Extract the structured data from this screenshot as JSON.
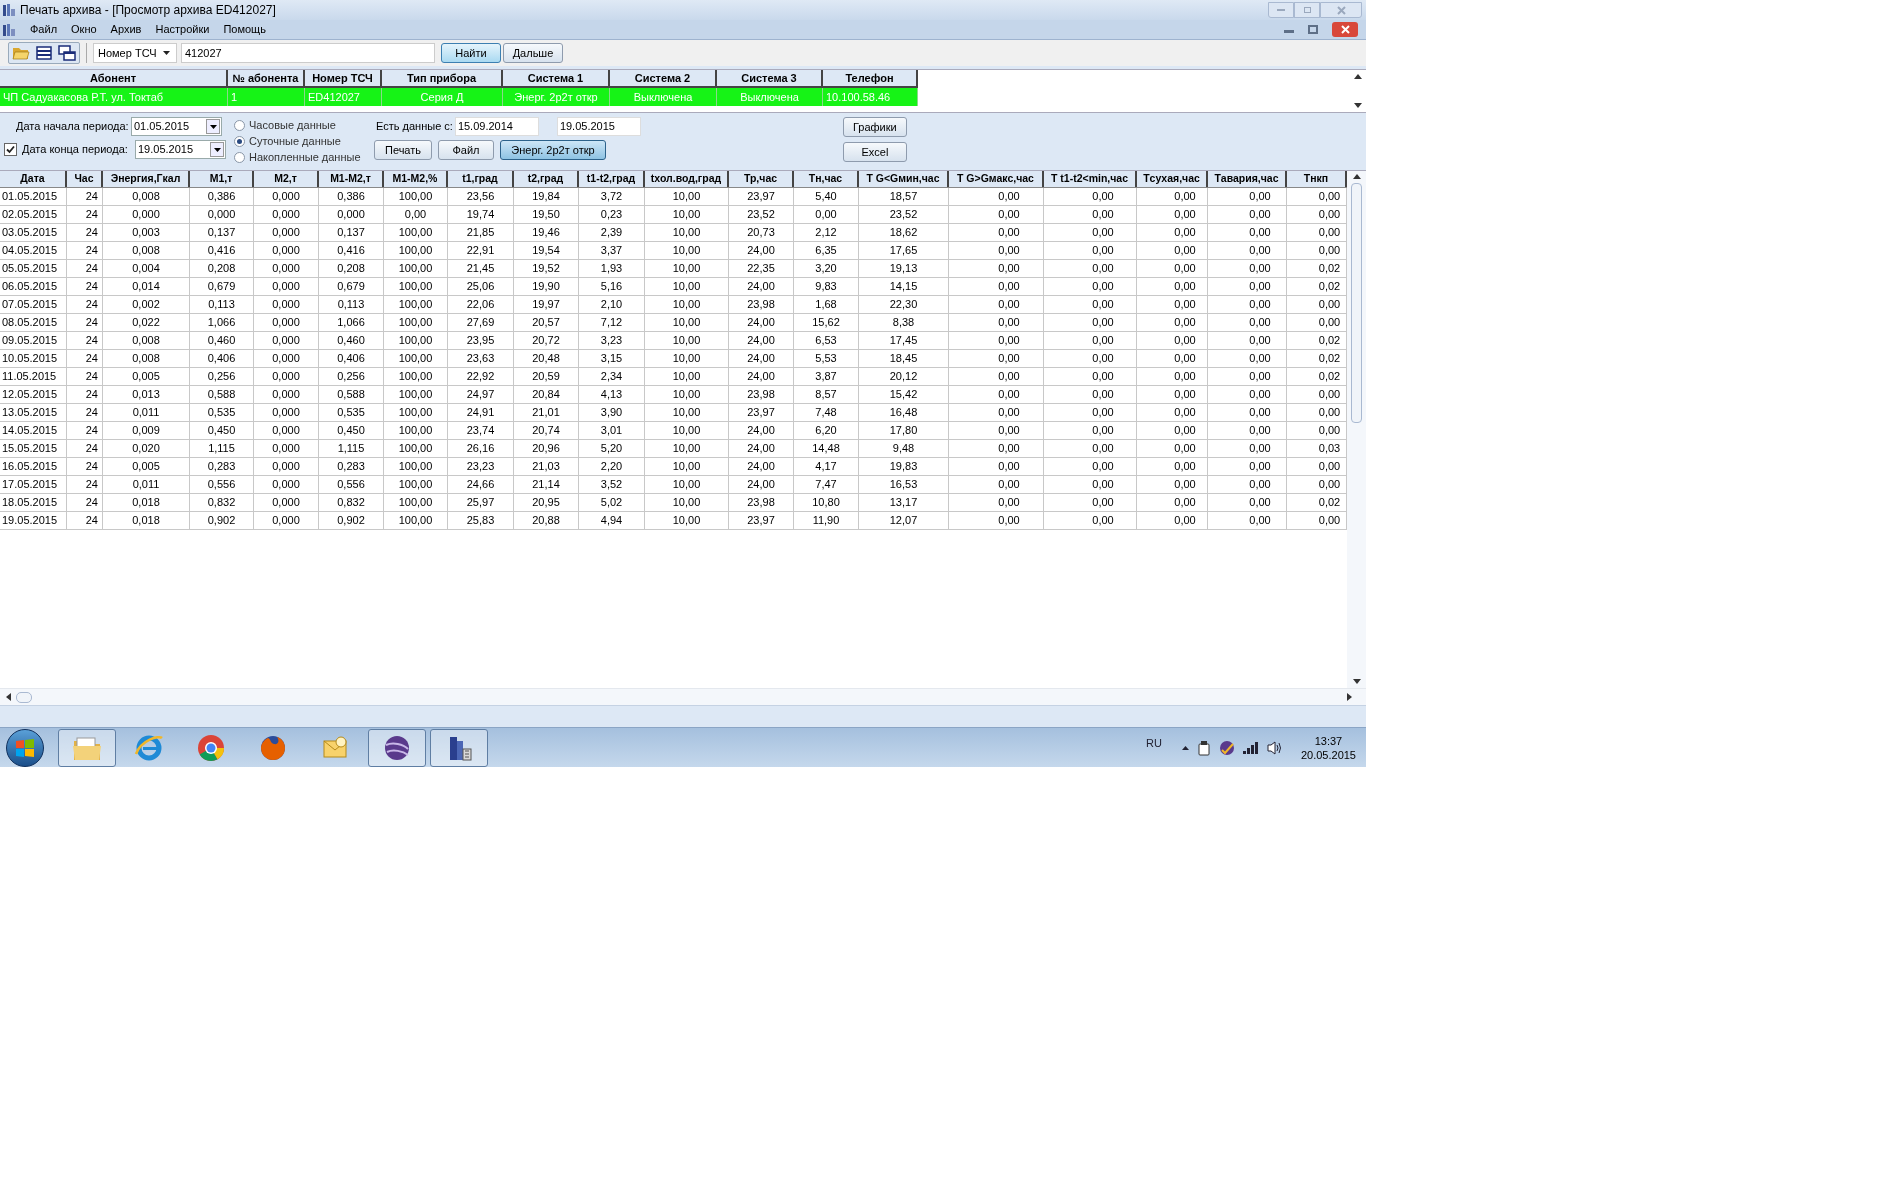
{
  "window": {
    "title": "Печать архива - [Просмотр архива ED412027]"
  },
  "menu": [
    "Файл",
    "Окно",
    "Архив",
    "Настройки",
    "Помощь"
  ],
  "toolbar": {
    "search_by": "Номер ТСЧ",
    "search_value": "412027",
    "buttons": [
      "Найти",
      "Дальше"
    ]
  },
  "subscribers": {
    "columns": [
      "Абонент",
      "№ абонента",
      "Номер ТСЧ",
      "Тип прибора",
      "Система 1",
      "Система 2",
      "Система 3",
      "Телефон"
    ],
    "rows": [
      {
        "selected": true,
        "cells": [
          "ЧП Садуакасова Р.Т. ул. Токтаб",
          "1",
          "ED412027",
          "Серия Д",
          "Энерг. 2р2т откр",
          "Выключена",
          "Выключена",
          "10.100.58.46"
        ]
      }
    ]
  },
  "period": {
    "start_label": "Дата начала периода:",
    "start": "01.05.2015",
    "end_label": "Дата конца периода:",
    "end": "19.05.2015",
    "end_checked": true,
    "modes": [
      {
        "label": "Часовые данные",
        "selected": false
      },
      {
        "label": "Суточные данные",
        "selected": true
      },
      {
        "label": "Накопленные данные",
        "selected": false
      }
    ],
    "available_label": "Есть данные с:",
    "available_from": "15.09.2014",
    "available_to": "19.05.2015",
    "buttons": [
      {
        "label": "Печать",
        "pressed": false
      },
      {
        "label": "Файл",
        "pressed": false
      },
      {
        "label": "Энерг. 2р2т откр",
        "pressed": true
      }
    ],
    "side_buttons": [
      "Графики",
      "Excel"
    ]
  },
  "table": {
    "columns": [
      "Дата",
      "Час",
      "Энергия,Гкал",
      "М1,т",
      "М2,т",
      "М1-М2,т",
      "М1-М2,%",
      "t1,град",
      "t2,град",
      "t1-t2,град",
      "tхол.вод,град",
      "Тр,час",
      "Тн,час",
      "T G<Gмин,час",
      "T G>Gмакс,час",
      "T t1-t2<min,час",
      "Tсухая,час",
      "Tавария,час",
      "Tнкп"
    ],
    "rows": [
      [
        "01.05.2015",
        "24",
        "0,008",
        "0,386",
        "0,000",
        "0,386",
        "100,00",
        "23,56",
        "19,84",
        "3,72",
        "10,00",
        "23,97",
        "5,40",
        "18,57",
        "0,00",
        "0,00",
        "0,00",
        "0,00",
        "0,00"
      ],
      [
        "02.05.2015",
        "24",
        "0,000",
        "0,000",
        "0,000",
        "0,000",
        "0,00",
        "19,74",
        "19,50",
        "0,23",
        "10,00",
        "23,52",
        "0,00",
        "23,52",
        "0,00",
        "0,00",
        "0,00",
        "0,00",
        "0,00"
      ],
      [
        "03.05.2015",
        "24",
        "0,003",
        "0,137",
        "0,000",
        "0,137",
        "100,00",
        "21,85",
        "19,46",
        "2,39",
        "10,00",
        "20,73",
        "2,12",
        "18,62",
        "0,00",
        "0,00",
        "0,00",
        "0,00",
        "0,00"
      ],
      [
        "04.05.2015",
        "24",
        "0,008",
        "0,416",
        "0,000",
        "0,416",
        "100,00",
        "22,91",
        "19,54",
        "3,37",
        "10,00",
        "24,00",
        "6,35",
        "17,65",
        "0,00",
        "0,00",
        "0,00",
        "0,00",
        "0,00"
      ],
      [
        "05.05.2015",
        "24",
        "0,004",
        "0,208",
        "0,000",
        "0,208",
        "100,00",
        "21,45",
        "19,52",
        "1,93",
        "10,00",
        "22,35",
        "3,20",
        "19,13",
        "0,00",
        "0,00",
        "0,00",
        "0,00",
        "0,02"
      ],
      [
        "06.05.2015",
        "24",
        "0,014",
        "0,679",
        "0,000",
        "0,679",
        "100,00",
        "25,06",
        "19,90",
        "5,16",
        "10,00",
        "24,00",
        "9,83",
        "14,15",
        "0,00",
        "0,00",
        "0,00",
        "0,00",
        "0,02"
      ],
      [
        "07.05.2015",
        "24",
        "0,002",
        "0,113",
        "0,000",
        "0,113",
        "100,00",
        "22,06",
        "19,97",
        "2,10",
        "10,00",
        "23,98",
        "1,68",
        "22,30",
        "0,00",
        "0,00",
        "0,00",
        "0,00",
        "0,00"
      ],
      [
        "08.05.2015",
        "24",
        "0,022",
        "1,066",
        "0,000",
        "1,066",
        "100,00",
        "27,69",
        "20,57",
        "7,12",
        "10,00",
        "24,00",
        "15,62",
        "8,38",
        "0,00",
        "0,00",
        "0,00",
        "0,00",
        "0,00"
      ],
      [
        "09.05.2015",
        "24",
        "0,008",
        "0,460",
        "0,000",
        "0,460",
        "100,00",
        "23,95",
        "20,72",
        "3,23",
        "10,00",
        "24,00",
        "6,53",
        "17,45",
        "0,00",
        "0,00",
        "0,00",
        "0,00",
        "0,02"
      ],
      [
        "10.05.2015",
        "24",
        "0,008",
        "0,406",
        "0,000",
        "0,406",
        "100,00",
        "23,63",
        "20,48",
        "3,15",
        "10,00",
        "24,00",
        "5,53",
        "18,45",
        "0,00",
        "0,00",
        "0,00",
        "0,00",
        "0,02"
      ],
      [
        "11.05.2015",
        "24",
        "0,005",
        "0,256",
        "0,000",
        "0,256",
        "100,00",
        "22,92",
        "20,59",
        "2,34",
        "10,00",
        "24,00",
        "3,87",
        "20,12",
        "0,00",
        "0,00",
        "0,00",
        "0,00",
        "0,02"
      ],
      [
        "12.05.2015",
        "24",
        "0,013",
        "0,588",
        "0,000",
        "0,588",
        "100,00",
        "24,97",
        "20,84",
        "4,13",
        "10,00",
        "23,98",
        "8,57",
        "15,42",
        "0,00",
        "0,00",
        "0,00",
        "0,00",
        "0,00"
      ],
      [
        "13.05.2015",
        "24",
        "0,011",
        "0,535",
        "0,000",
        "0,535",
        "100,00",
        "24,91",
        "21,01",
        "3,90",
        "10,00",
        "23,97",
        "7,48",
        "16,48",
        "0,00",
        "0,00",
        "0,00",
        "0,00",
        "0,00"
      ],
      [
        "14.05.2015",
        "24",
        "0,009",
        "0,450",
        "0,000",
        "0,450",
        "100,00",
        "23,74",
        "20,74",
        "3,01",
        "10,00",
        "24,00",
        "6,20",
        "17,80",
        "0,00",
        "0,00",
        "0,00",
        "0,00",
        "0,00"
      ],
      [
        "15.05.2015",
        "24",
        "0,020",
        "1,115",
        "0,000",
        "1,115",
        "100,00",
        "26,16",
        "20,96",
        "5,20",
        "10,00",
        "24,00",
        "14,48",
        "9,48",
        "0,00",
        "0,00",
        "0,00",
        "0,00",
        "0,03"
      ],
      [
        "16.05.2015",
        "24",
        "0,005",
        "0,283",
        "0,000",
        "0,283",
        "100,00",
        "23,23",
        "21,03",
        "2,20",
        "10,00",
        "24,00",
        "4,17",
        "19,83",
        "0,00",
        "0,00",
        "0,00",
        "0,00",
        "0,00"
      ],
      [
        "17.05.2015",
        "24",
        "0,011",
        "0,556",
        "0,000",
        "0,556",
        "100,00",
        "24,66",
        "21,14",
        "3,52",
        "10,00",
        "24,00",
        "7,47",
        "16,53",
        "0,00",
        "0,00",
        "0,00",
        "0,00",
        "0,00"
      ],
      [
        "18.05.2015",
        "24",
        "0,018",
        "0,832",
        "0,000",
        "0,832",
        "100,00",
        "25,97",
        "20,95",
        "5,02",
        "10,00",
        "23,98",
        "10,80",
        "13,17",
        "0,00",
        "0,00",
        "0,00",
        "0,00",
        "0,02"
      ],
      [
        "19.05.2015",
        "24",
        "0,018",
        "0,902",
        "0,000",
        "0,902",
        "100,00",
        "25,83",
        "20,88",
        "4,94",
        "10,00",
        "23,97",
        "11,90",
        "12,07",
        "0,00",
        "0,00",
        "0,00",
        "0,00",
        "0,00"
      ]
    ]
  },
  "taskbar": {
    "apps": [
      {
        "kind": "folder",
        "active": true
      },
      {
        "kind": "ie",
        "active": false
      },
      {
        "kind": "chrome",
        "active": false
      },
      {
        "kind": "firefox",
        "active": false
      },
      {
        "kind": "mail",
        "active": false
      },
      {
        "kind": "sphere",
        "active": true
      },
      {
        "kind": "building",
        "active": true
      }
    ],
    "language": "RU",
    "time": "13:37",
    "date": "20.05.2015"
  }
}
